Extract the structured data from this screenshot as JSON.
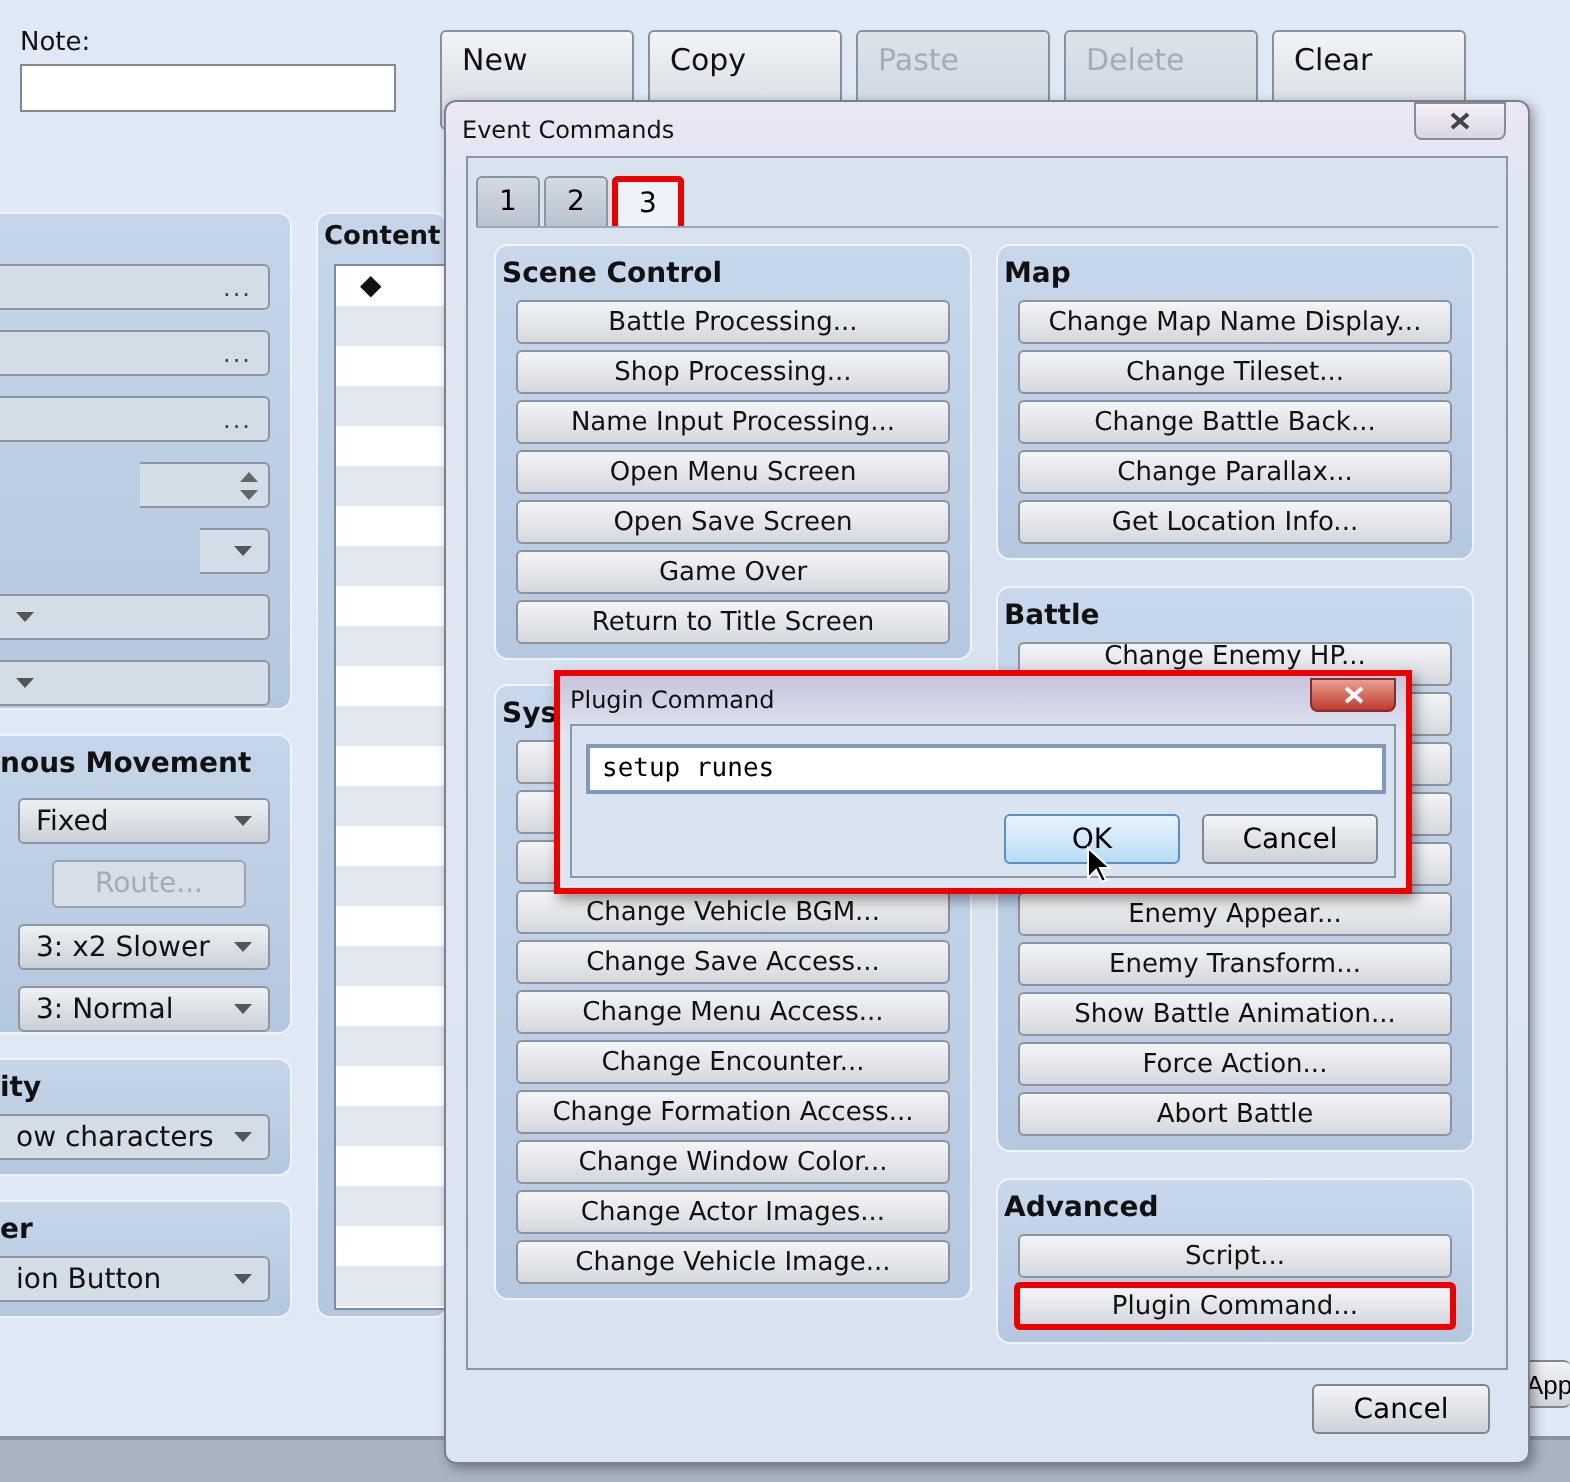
{
  "note": {
    "label": "Note:"
  },
  "page_buttons": [
    {
      "label": "New",
      "disabled": false
    },
    {
      "label": "Copy",
      "disabled": false
    },
    {
      "label": "Paste",
      "disabled": true
    },
    {
      "label": "Delete",
      "disabled": true
    },
    {
      "label": "Clear",
      "disabled": false
    }
  ],
  "conditions": {
    "fields": [
      {
        "kind": "ellipsis",
        "text": "..."
      },
      {
        "kind": "ellipsis",
        "text": "..."
      },
      {
        "kind": "ellipsis",
        "text": "..."
      },
      {
        "kind": "spinner"
      },
      {
        "kind": "short-dropdown"
      },
      {
        "kind": "dropdown"
      },
      {
        "kind": "dropdown"
      }
    ]
  },
  "movement": {
    "title": "nous Movement",
    "type": "Fixed",
    "route": {
      "label": "Route...",
      "disabled": true
    },
    "speed": "3: x2 Slower",
    "frequency": "3: Normal"
  },
  "priority": {
    "title": "ity",
    "value": "ow characters"
  },
  "trigger": {
    "title": "er",
    "value": "ion Button"
  },
  "contents": {
    "label": "Content",
    "first_row": "◆"
  },
  "apply_button": "App",
  "event_commands": {
    "title": "Event Commands",
    "tabs": [
      {
        "label": "1",
        "selected": false,
        "highlighted": false
      },
      {
        "label": "2",
        "selected": false,
        "highlighted": false
      },
      {
        "label": "3",
        "selected": true,
        "highlighted": true
      }
    ],
    "columns": [
      {
        "groups": [
          {
            "title": "Scene Control",
            "commands": [
              {
                "label": "Battle Processing..."
              },
              {
                "label": "Shop Processing..."
              },
              {
                "label": "Name Input Processing..."
              },
              {
                "label": "Open Menu Screen"
              },
              {
                "label": "Open Save Screen"
              },
              {
                "label": "Game Over"
              },
              {
                "label": "Return to Title Screen"
              }
            ]
          },
          {
            "title": "Sys",
            "commands": [
              {
                "kind": "blank"
              },
              {
                "kind": "blank"
              },
              {
                "kind": "blank"
              },
              {
                "label": "Change Vehicle BGM..."
              },
              {
                "label": "Change Save Access..."
              },
              {
                "label": "Change Menu Access..."
              },
              {
                "label": "Change Encounter..."
              },
              {
                "label": "Change Formation Access..."
              },
              {
                "label": "Change Window Color..."
              },
              {
                "label": "Change Actor Images..."
              },
              {
                "label": "Change Vehicle Image..."
              }
            ]
          }
        ]
      },
      {
        "groups": [
          {
            "title": "Map",
            "commands": [
              {
                "label": "Change Map Name Display..."
              },
              {
                "label": "Change Tileset..."
              },
              {
                "label": "Change Battle Back..."
              },
              {
                "label": "Change Parallax..."
              },
              {
                "label": "Get Location Info..."
              }
            ]
          },
          {
            "title": "Battle",
            "commands": [
              {
                "label": "Change Enemy HP..."
              },
              {
                "kind": "blank"
              },
              {
                "kind": "blank"
              },
              {
                "kind": "blank"
              },
              {
                "kind": "blank"
              },
              {
                "label": "Enemy Appear..."
              },
              {
                "label": "Enemy Transform..."
              },
              {
                "label": "Show Battle Animation..."
              },
              {
                "label": "Force Action..."
              },
              {
                "label": "Abort Battle"
              }
            ]
          },
          {
            "title": "Advanced",
            "commands": [
              {
                "label": "Script..."
              },
              {
                "label": "Plugin Command...",
                "highlighted": true
              }
            ]
          }
        ]
      }
    ],
    "cancel": "Cancel"
  },
  "plugin_dialog": {
    "title": "Plugin Command",
    "highlighted": true,
    "value": "setup runes",
    "ok": {
      "label": "OK",
      "hovered": true
    },
    "cancel": {
      "label": "Cancel",
      "hovered": false
    }
  }
}
